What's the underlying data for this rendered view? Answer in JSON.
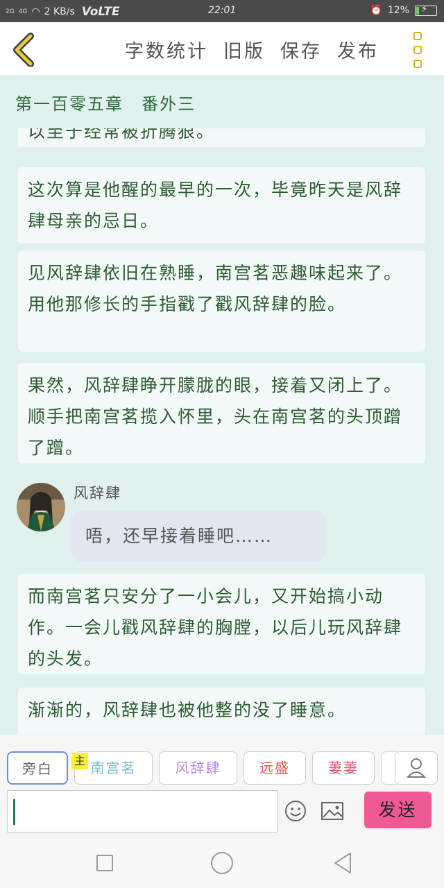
{
  "status_bar": {
    "signal_1": "2G",
    "signal_2": "4G",
    "speed": "2 KB/s",
    "network": "VoLTE",
    "time": "22:01",
    "battery": "12%",
    "battery_level": 0.12
  },
  "toolbar": {
    "back_icon": "chevron-left-icon",
    "word_count": "字数统计",
    "old_version": "旧版",
    "save": "保存",
    "publish": "发布",
    "menu_icon": "more-vertical-icon"
  },
  "chapter_title": "第一百零五章　番外三",
  "paragraphs": [
    "以至于经常被折腾狠。",
    "这次算是他醒的最早的一次，毕竟昨天是风辞肆母亲的忌日。",
    "见风辞肆依旧在熟睡，南宫茗恶趣味起来了。用他那修长的手指戳了戳风辞肆的脸。",
    "果然，风辞肆睁开朦胧的眼，接着又闭上了。顺手把南宫茗揽入怀里，头在南宫茗的头顶蹭了蹭。",
    "而南宫茗只安分了一小会儿，又开始搞小动作。一会儿戳风辞肆的胸膛，以后儿玩风辞肆的头发。",
    "渐渐的，风辞肆也被他整的没了睡意。"
  ],
  "dialogue": {
    "speaker": "风辞肆",
    "text": "唔，还早接着睡吧……",
    "avatar_icon": "character-avatar"
  },
  "characters": {
    "narrator": "旁白",
    "main_tag": "主",
    "nangong": "南宫茗",
    "feng": "风辞肆",
    "yuansheng": "远盛",
    "qiqi": "萋萋",
    "person_icon": "user-icon"
  },
  "composer": {
    "input_value": "",
    "emoji_icon": "emoji-icon",
    "image_icon": "image-icon",
    "send": "发送"
  },
  "colors": {
    "background": "#dff0ee",
    "text_green": "#2d5b33",
    "send_pink": "#f05a94",
    "accent_yellow": "#d8b020"
  }
}
